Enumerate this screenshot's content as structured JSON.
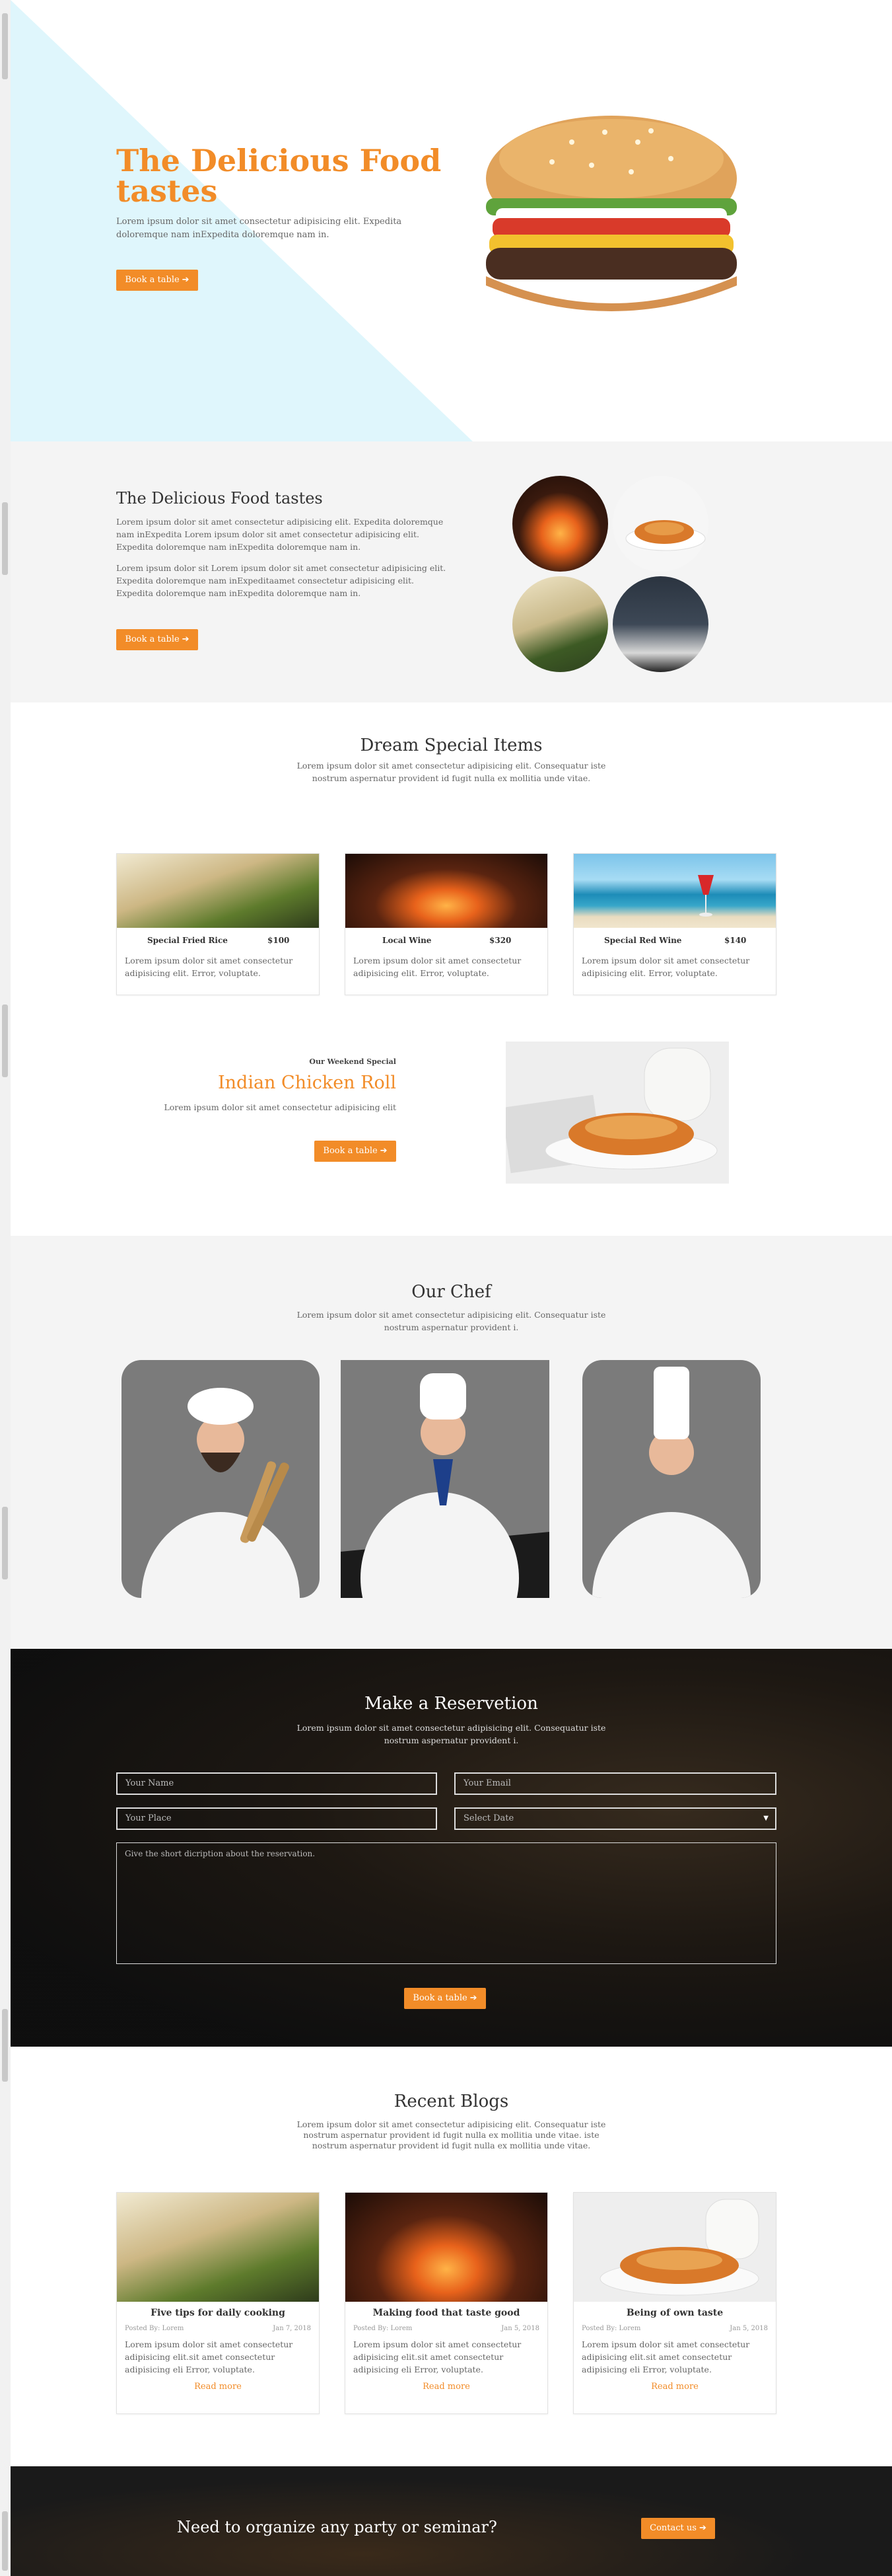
{
  "hero": {
    "title": "The Delicious Food tastes",
    "text": "Lorem ipsum dolor sit amet consectetur adipisicing elit. Expedita doloremque nam inExpedita doloremque nam in.",
    "button": "Book a table"
  },
  "about": {
    "title": "The Delicious Food tastes",
    "text1": "Lorem ipsum dolor sit amet consectetur adipisicing elit. Expedita doloremque nam inExpedita Lorem ipsum dolor sit amet consectetur adipisicing elit. Expedita doloremque nam inExpedita doloremque nam in.",
    "text2": "Lorem ipsum dolor sit Lorem ipsum dolor sit amet consectetur adipisicing elit. Expedita doloremque nam inExpeditaamet consectetur adipisicing elit. Expedita doloremque nam inExpedita doloremque nam in.",
    "button": "Book a table"
  },
  "special": {
    "title": "Dream Special Items",
    "text": "Lorem ipsum dolor sit amet consectetur adipisicing elit. Consequatur iste nostrum aspernatur provident id fugit nulla ex mollitia unde vitae.",
    "items": [
      {
        "name": "Special Fried Rice",
        "price": "$100",
        "text": "Lorem ipsum dolor sit amet consectetur adipisicing elit. Error, voluptate."
      },
      {
        "name": "Local Wine",
        "price": "$320",
        "text": "Lorem ipsum dolor sit amet consectetur adipisicing elit. Error, voluptate."
      },
      {
        "name": "Special Red Wine",
        "price": "$140",
        "text": "Lorem ipsum dolor sit amet consectetur adipisicing elit. Error, voluptate."
      }
    ]
  },
  "weekend": {
    "label": "Our Weekend Special",
    "title": "Indian Chicken Roll",
    "text": "Lorem ipsum dolor sit amet consectetur adipisicing elit",
    "button": "Book a table"
  },
  "chef": {
    "title": "Our Chef",
    "text": "Lorem ipsum dolor sit amet consectetur adipisicing elit. Consequatur iste nostrum aspernatur provident i."
  },
  "reservation": {
    "title": "Make a Reservetion",
    "text": "Lorem ipsum dolor sit amet consectetur adipisicing elit. Consequatur iste nostrum aspernatur provident i.",
    "name_placeholder": "Your Name",
    "email_placeholder": "Your Email",
    "place_placeholder": "Your Place",
    "date_placeholder": "Select Date",
    "desc_placeholder": "Give the short dicription about the reservation.",
    "button": "Book a table"
  },
  "blogs": {
    "title": "Recent Blogs",
    "text": "Lorem ipsum dolor sit amet consectetur adipisicing elit. Consequatur iste nostrum aspernatur provident id fugit nulla ex mollitia unde vitae. iste nostrum aspernatur provident id fugit nulla ex mollitia unde vitae.",
    "items": [
      {
        "title": "Five tips for daily cooking",
        "author": "Posted By: Lorem",
        "date": "Jan 7, 2018",
        "text": "Lorem ipsum dolor sit amet consectetur adipisicing elit.sit amet consectetur adipisicing eli Error, voluptate.",
        "more": "Read more"
      },
      {
        "title": "Making food that taste good",
        "author": "Posted By: Lorem",
        "date": "Jan 5, 2018",
        "text": "Lorem ipsum dolor sit amet consectetur adipisicing elit.sit amet consectetur adipisicing eli Error, voluptate.",
        "more": "Read more"
      },
      {
        "title": "Being of own taste",
        "author": "Posted By: Lorem",
        "date": "Jan 5, 2018",
        "text": "Lorem ipsum dolor sit amet consectetur adipisicing elit.sit amet consectetur adipisicing eli Error, voluptate.",
        "more": "Read more"
      }
    ]
  },
  "cta": {
    "text": "Need to organize any party or seminar?",
    "button": "Contact us"
  },
  "colors": {
    "accent": "#f28c28",
    "dark": "#1a1a1a",
    "light_bg": "#f4f4f4",
    "hero_tint": "#dff6fc"
  }
}
